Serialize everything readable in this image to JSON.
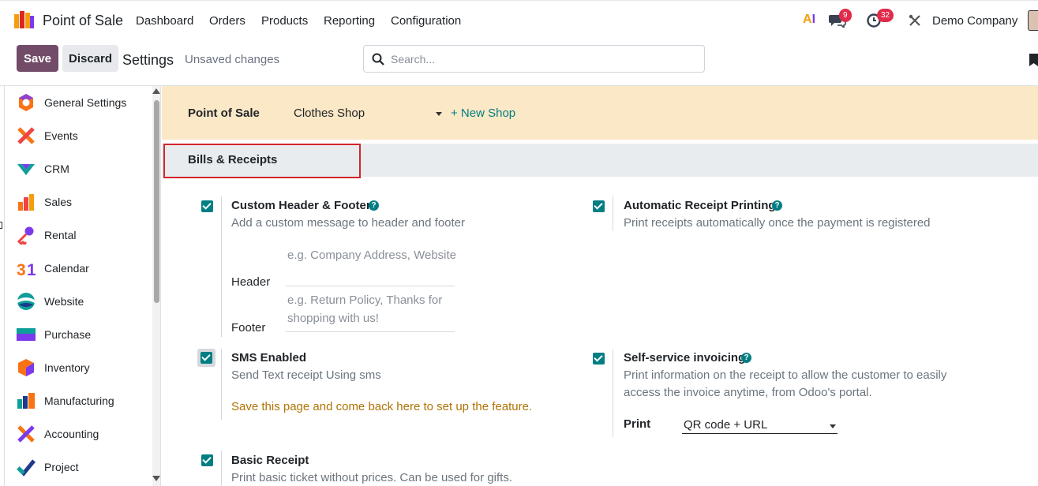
{
  "app": {
    "name": "Point of Sale"
  },
  "nav": {
    "items": [
      "Dashboard",
      "Orders",
      "Products",
      "Reporting",
      "Configuration"
    ],
    "ai_label": "AI",
    "messages_count": "9",
    "activities_count": "32",
    "company": "Demo Company"
  },
  "control": {
    "save_label": "Save",
    "discard_label": "Discard",
    "title": "Settings",
    "status": "Unsaved changes",
    "search_placeholder": "Search..."
  },
  "sidebar": {
    "items": [
      {
        "label": "General Settings",
        "icon": "general-settings-icon"
      },
      {
        "label": "Events",
        "icon": "events-icon"
      },
      {
        "label": "CRM",
        "icon": "crm-icon"
      },
      {
        "label": "Sales",
        "icon": "sales-icon"
      },
      {
        "label": "Rental",
        "icon": "rental-icon"
      },
      {
        "label": "Calendar",
        "icon": "calendar-icon"
      },
      {
        "label": "Website",
        "icon": "website-icon"
      },
      {
        "label": "Purchase",
        "icon": "purchase-icon"
      },
      {
        "label": "Inventory",
        "icon": "inventory-icon"
      },
      {
        "label": "Manufacturing",
        "icon": "manufacturing-icon"
      },
      {
        "label": "Accounting",
        "icon": "accounting-icon"
      },
      {
        "label": "Project",
        "icon": "project-icon"
      }
    ]
  },
  "shop_bar": {
    "label": "Point of Sale",
    "selected_shop": "Clothes Shop",
    "new_shop_label": "+ New Shop"
  },
  "section": {
    "title": "Bills & Receipts"
  },
  "options": {
    "custom_header_footer": {
      "title": "Custom Header & Footer",
      "desc": "Add a custom message to header and footer",
      "checked": true,
      "header_label": "Header",
      "header_placeholder": "e.g. Company Address, Website",
      "footer_label": "Footer",
      "footer_placeholder_line1": "e.g. Return Policy, Thanks for",
      "footer_placeholder_line2": "shopping with us!"
    },
    "automatic_receipt_printing": {
      "title": "Automatic Receipt Printing",
      "desc": "Print receipts automatically once the payment is registered",
      "checked": true
    },
    "sms_enabled": {
      "title": "SMS Enabled",
      "desc": "Send Text receipt Using sms",
      "warning": "Save this page and come back here to set up the feature.",
      "checked": true
    },
    "self_service_invoicing": {
      "title": "Self-service invoicing",
      "desc_line1": "Print information on the receipt to allow the customer to easily",
      "desc_line2": "access the invoice anytime, from Odoo's portal.",
      "checked": true,
      "print_label": "Print",
      "print_value": "QR code + URL"
    },
    "basic_receipt": {
      "title": "Basic Receipt",
      "desc": "Print basic ticket without prices. Can be used for gifts.",
      "checked": true
    }
  },
  "colors": {
    "brand": "#714b67",
    "accent": "#017e84",
    "shop_band": "#fbe8c6",
    "section_band": "#e9ecef",
    "highlight": "#d3242b",
    "warning": "#b07304"
  }
}
